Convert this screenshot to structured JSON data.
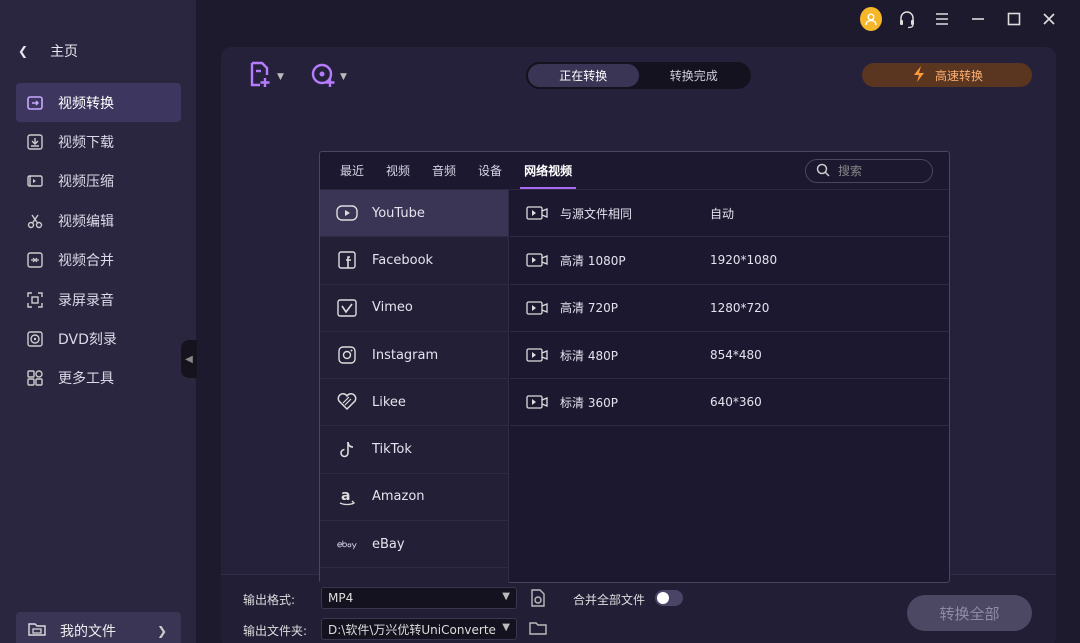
{
  "sidebar": {
    "home_label": "主页",
    "items": [
      {
        "label": "视频转换",
        "icon": "convert-icon"
      },
      {
        "label": "视频下载",
        "icon": "download-icon"
      },
      {
        "label": "视频压缩",
        "icon": "compress-icon"
      },
      {
        "label": "视频编辑",
        "icon": "scissors-icon"
      },
      {
        "label": "视频合并",
        "icon": "merge-icon"
      },
      {
        "label": "录屏录音",
        "icon": "record-icon"
      },
      {
        "label": "DVD刻录",
        "icon": "disc-icon"
      },
      {
        "label": "更多工具",
        "icon": "tools-grid-icon"
      }
    ],
    "active_index": 0,
    "my_files_label": "我的文件"
  },
  "toolbar": {
    "tabs": [
      "正在转换",
      "转换完成"
    ],
    "active_tab": 0,
    "fast_convert_label": "高速转换"
  },
  "format_panel": {
    "tabs": [
      "最近",
      "视频",
      "音频",
      "设备",
      "网络视频"
    ],
    "active_tab": 4,
    "search_placeholder": "搜索",
    "platforms": [
      "YouTube",
      "Facebook",
      "Vimeo",
      "Instagram",
      "Likee",
      "TikTok",
      "Amazon",
      "eBay"
    ],
    "active_platform": 0,
    "qualities": [
      {
        "name": "与源文件相同",
        "resolution": "自动"
      },
      {
        "name": "高清 1080P",
        "resolution": "1920*1080"
      },
      {
        "name": "高清 720P",
        "resolution": "1280*720"
      },
      {
        "name": "标清 480P",
        "resolution": "854*480"
      },
      {
        "name": "标清 360P",
        "resolution": "640*360"
      }
    ]
  },
  "bottom": {
    "output_format_label": "输出格式:",
    "output_format_value": "MP4",
    "merge_all_label": "合并全部文件",
    "output_folder_label": "输出文件夹:",
    "output_folder_value": "D:\\软件\\万兴优转UniConverte",
    "convert_all_label": "转换全部"
  },
  "colors": {
    "accent": "#a86af5",
    "fast_convert": "#ffb070",
    "avatar": "#f6b62a"
  }
}
